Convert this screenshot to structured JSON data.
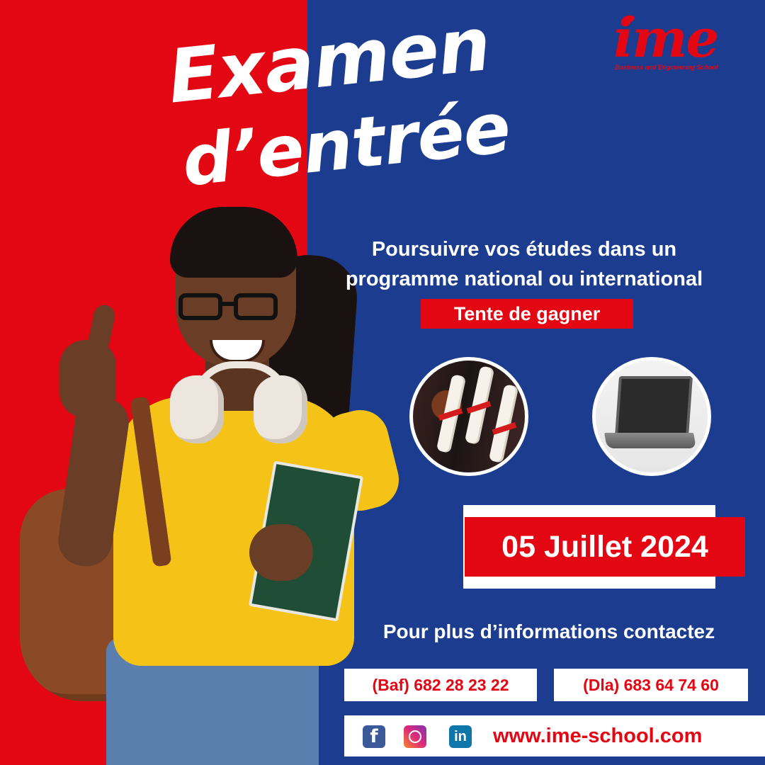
{
  "headline": {
    "line1": "Examen",
    "line2": "d’entrée"
  },
  "logo": {
    "word": "ime",
    "tagline": "Business and Engineering School"
  },
  "subtitle": {
    "line1": "Poursuivre vos études dans un",
    "line2": "programme national ou international",
    "prize_label": "Tente de gagner"
  },
  "prizes": [
    "diploma-scrolls-image",
    "laptop-image"
  ],
  "date": "05 Juillet 2024",
  "contact": {
    "heading": "Pour plus d’informations contactez",
    "phone_baf": "(Baf) 682 28 23 22",
    "phone_dla": "(Dla) 683 64 74 60"
  },
  "social": {
    "facebook": "f",
    "linkedin": "in",
    "website": "www.ime-school.com"
  },
  "colors": {
    "red": "#e30613",
    "blue": "#1c3d8f",
    "white": "#ffffff"
  }
}
